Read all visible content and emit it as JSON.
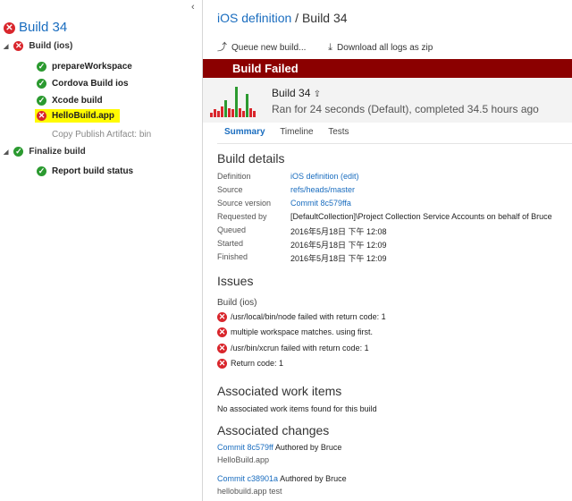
{
  "left_panel": {
    "collapse_glyph": "‹",
    "build_title": "Build 34",
    "tree": [
      {
        "label": "Build (ios)",
        "level": 0,
        "status": "fail",
        "expanded": true
      },
      {
        "label": "prepareWorkspace",
        "level": 1,
        "status": "ok"
      },
      {
        "label": "Cordova Build ios",
        "level": 1,
        "status": "ok"
      },
      {
        "label": "Xcode build",
        "level": 1,
        "status": "ok"
      },
      {
        "label": "HelloBuild.app",
        "level": 1,
        "status": "fail",
        "highlighted": true
      },
      {
        "label": "Copy Publish Artifact: bin",
        "level": 1,
        "status": "none"
      },
      {
        "label": "Finalize build",
        "level": 0,
        "status": "ok",
        "expanded": true
      },
      {
        "label": "Report build status",
        "level": 1,
        "status": "ok"
      }
    ]
  },
  "header": {
    "definition_link": "iOS definition",
    "separator": "/",
    "build_name": "Build 34"
  },
  "toolbar": {
    "queue_label": "Queue new build...",
    "download_label": "Download all logs as zip"
  },
  "status_banner": "Build Failed",
  "summary": {
    "title": "Build 34",
    "subtitle": "Ran for 24 seconds (Default), completed 34.5 hours ago",
    "history_bars": [
      {
        "value": 0.15,
        "status": "fail"
      },
      {
        "value": 0.25,
        "status": "fail"
      },
      {
        "value": 0.2,
        "status": "fail"
      },
      {
        "value": 0.35,
        "status": "fail"
      },
      {
        "value": 0.55,
        "status": "ok"
      },
      {
        "value": 0.3,
        "status": "fail"
      },
      {
        "value": 0.25,
        "status": "fail"
      },
      {
        "value": 1.0,
        "status": "ok"
      },
      {
        "value": 0.3,
        "status": "fail"
      },
      {
        "value": 0.22,
        "status": "fail"
      },
      {
        "value": 0.75,
        "status": "ok"
      },
      {
        "value": 0.28,
        "status": "fail"
      },
      {
        "value": 0.2,
        "status": "fail"
      }
    ]
  },
  "tabs": [
    "Summary",
    "Timeline",
    "Tests"
  ],
  "build_details": {
    "heading": "Build details",
    "rows": [
      {
        "label": "Definition",
        "value": "iOS definition (edit)",
        "link": true
      },
      {
        "label": "Source",
        "value": "refs/heads/master",
        "link": true
      },
      {
        "label": "Source version",
        "value": "Commit 8c579ffa",
        "link": true
      },
      {
        "label": "Requested by",
        "value": "[DefaultCollection]\\Project Collection Service Accounts on behalf of Bruce",
        "link": false
      },
      {
        "label": "Queued",
        "value": "2016年5月18日 下午 12:08",
        "link": false
      },
      {
        "label": "Started",
        "value": "2016年5月18日 下午 12:09",
        "link": false
      },
      {
        "label": "Finished",
        "value": "2016年5月18日 下午 12:09",
        "link": false
      }
    ]
  },
  "issues": {
    "heading": "Issues",
    "group": "Build (ios)",
    "items": [
      "/usr/local/bin/node failed with return code: 1",
      "multiple workspace matches. using first.",
      "/usr/bin/xcrun failed with return code: 1",
      "Return code: 1"
    ]
  },
  "work_items": {
    "heading": "Associated work items",
    "empty_text": "No associated work items found for this build"
  },
  "changes": {
    "heading": "Associated changes",
    "items": [
      {
        "commit": "Commit 8c579ff",
        "author": "Authored by Bruce",
        "message": "HelloBuild.app"
      },
      {
        "commit": "Commit c38901a",
        "author": "Authored by Bruce",
        "message": "hellobuild.app test"
      }
    ]
  },
  "colors": {
    "link": "#1a6dbf",
    "fail": "#d9262c",
    "ok": "#2b9a30",
    "banner": "#8b0000",
    "highlight": "#fffb00"
  }
}
